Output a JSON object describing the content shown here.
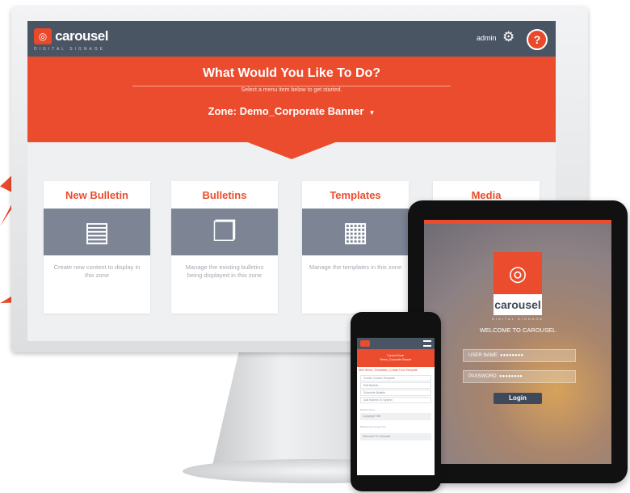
{
  "desktop": {
    "brand": "carousel",
    "brand_sub": "DIGITAL SIGNAGE",
    "user": "admin",
    "help_label": "?",
    "heading": "What Would You Like To Do?",
    "subheading": "Select a menu item below to get started.",
    "zone_label": "Zone: Demo_Corporate Banner",
    "cards": [
      {
        "title": "New Bulletin",
        "icon": "document-icon",
        "description": "Create new content to display in this zone"
      },
      {
        "title": "Bulletins",
        "icon": "documents-icon",
        "description": "Manage the existing bulletins being displayed in this zone"
      },
      {
        "title": "Templates",
        "icon": "template-icon",
        "description": "Manage the templates in this zone"
      },
      {
        "title": "Media",
        "icon": "media-icon",
        "description": ""
      }
    ]
  },
  "tablet": {
    "brand": "carousel",
    "brand_sub": "DIGITAL SIGNAGE",
    "welcome": "WELCOME TO CAROUSEL",
    "username_label": "USER NAME: ●●●●●●●●",
    "password_label": "PASSWORD: ●●●●●●●●",
    "login_button": "Login"
  },
  "phone": {
    "zone_line1": "Current Zone:",
    "zone_line2": "Demo_Corporate Banner",
    "tabs": "New Items | Templates | Create From Template",
    "menu_items": [
      "Create Custom Template",
      "Edit Bulletin",
      "Schedule Bulletin",
      "Add Bulletin To System"
    ],
    "field1_label": "Bulletin Name",
    "field1_value": "Copyright Title",
    "field2_label": "Background Image Title",
    "field2_value": "Welcome To Carousel"
  },
  "colors": {
    "accent": "#eb4c2d",
    "header": "#4a5564",
    "icon_band": "#7d8595"
  }
}
